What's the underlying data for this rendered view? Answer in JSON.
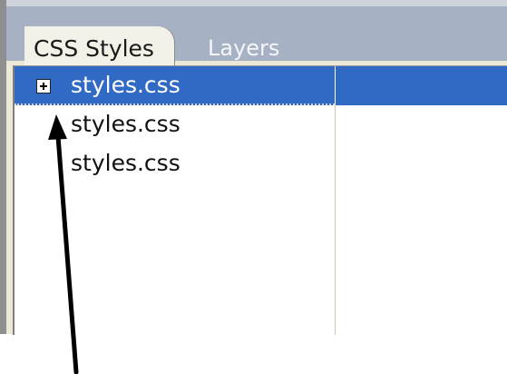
{
  "tabs": [
    {
      "label": "CSS Styles",
      "active": true
    },
    {
      "label": "Layers",
      "active": false
    }
  ],
  "style_list": [
    {
      "label": "styles.css",
      "selected": true,
      "icon": "plus-expand-icon"
    },
    {
      "label": "styles.css",
      "selected": false
    },
    {
      "label": "styles.css",
      "selected": false
    }
  ],
  "colors": {
    "selection": "#316ac5",
    "tab_bar": "#a6b1c3",
    "panel_bg": "#ece9d8"
  }
}
